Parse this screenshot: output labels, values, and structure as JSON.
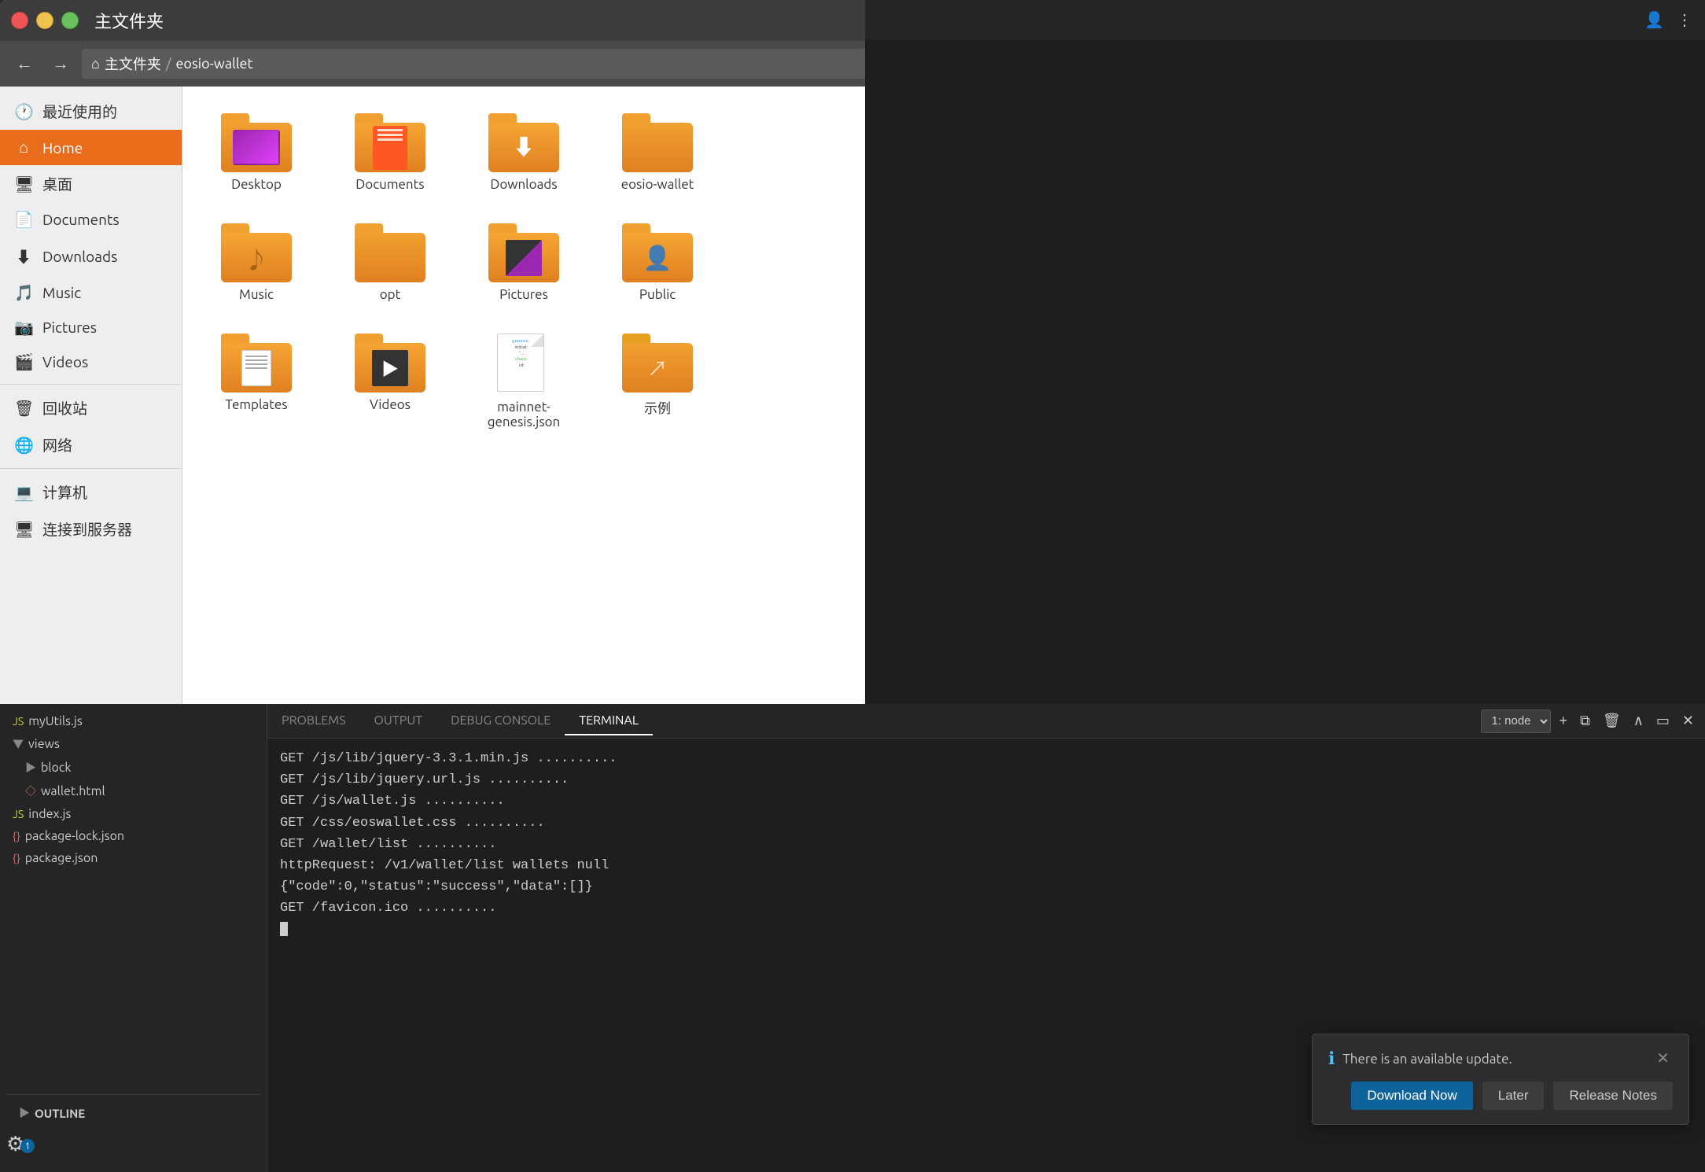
{
  "window": {
    "title": "主文件夹",
    "breadcrumb_home": "⌂主文件夹",
    "breadcrumb_sep": "/",
    "breadcrumb_sub": "eosio-wallet"
  },
  "sidebar": {
    "items": [
      {
        "id": "recent",
        "label": "最近使用的",
        "icon": "🕐"
      },
      {
        "id": "home",
        "label": "Home",
        "icon": "🏠",
        "active": true
      },
      {
        "id": "desktop",
        "label": "桌面",
        "icon": "🖥"
      },
      {
        "id": "documents",
        "label": "Documents",
        "icon": "📄"
      },
      {
        "id": "downloads",
        "label": "Downloads",
        "icon": "⬇"
      },
      {
        "id": "music",
        "label": "Music",
        "icon": "🎵"
      },
      {
        "id": "pictures",
        "label": "Pictures",
        "icon": "📷"
      },
      {
        "id": "videos",
        "label": "Videos",
        "icon": "🎬"
      },
      {
        "id": "trash",
        "label": "回收站",
        "icon": "🗑"
      },
      {
        "id": "network",
        "label": "网络",
        "icon": "🌐"
      },
      {
        "id": "computer",
        "label": "计算机",
        "icon": "💻"
      },
      {
        "id": "server",
        "label": "连接到服务器",
        "icon": "🖧"
      }
    ]
  },
  "files": [
    {
      "id": "desktop",
      "name": "Desktop",
      "type": "folder-desktop"
    },
    {
      "id": "documents",
      "name": "Documents",
      "type": "folder-documents"
    },
    {
      "id": "downloads",
      "name": "Downloads",
      "type": "folder-downloads"
    },
    {
      "id": "eosio-wallet",
      "name": "eosio-wallet",
      "type": "folder-plain"
    },
    {
      "id": "music",
      "name": "Music",
      "type": "folder-music"
    },
    {
      "id": "opt",
      "name": "opt",
      "type": "folder-plain"
    },
    {
      "id": "pictures",
      "name": "Pictures",
      "type": "folder-pictures"
    },
    {
      "id": "public",
      "name": "Public",
      "type": "folder-public"
    },
    {
      "id": "templates",
      "name": "Templates",
      "type": "folder-templates"
    },
    {
      "id": "videos",
      "name": "Videos",
      "type": "folder-videos"
    },
    {
      "id": "json",
      "name": "mainnet-genesis.\njson",
      "type": "file-json"
    },
    {
      "id": "example",
      "name": "示例",
      "type": "folder-share"
    }
  ],
  "terminal": {
    "tabs": [
      {
        "label": "PROBLEMS",
        "active": false
      },
      {
        "label": "OUTPUT",
        "active": false
      },
      {
        "label": "DEBUG CONSOLE",
        "active": false
      },
      {
        "label": "TERMINAL",
        "active": true
      }
    ],
    "selector": "1: node",
    "lines": [
      "GET /js/lib/jquery-3.3.1.min.js ..........",
      "GET /js/lib/jquery.url.js ..........",
      "GET /js/wallet.js ..........",
      "GET /css/eoswallet.css ..........",
      "GET /wallet/list ..........",
      "httpRequest: /v1/wallet/list wallets null",
      "{\"code\":0,\"status\":\"success\",\"data\":[]}",
      "GET /favicon.ico .........."
    ]
  },
  "explorer": {
    "items": [
      {
        "label": "myUtils.js",
        "type": "js",
        "indent": 0
      },
      {
        "label": "views",
        "type": "folder",
        "indent": 0,
        "expanded": true
      },
      {
        "label": "block",
        "type": "folder",
        "indent": 1,
        "expanded": false
      },
      {
        "label": "wallet.html",
        "type": "html",
        "indent": 1
      },
      {
        "label": "index.js",
        "type": "js",
        "indent": 0
      },
      {
        "label": "package-lock.json",
        "type": "json",
        "indent": 0
      },
      {
        "label": "package.json",
        "type": "json",
        "indent": 0
      }
    ],
    "outline": "OUTLINE"
  },
  "notification": {
    "icon": "ℹ",
    "message": "There is an available update.",
    "btn_download": "Download Now",
    "btn_later": "Later",
    "btn_release": "Release Notes"
  },
  "gear": {
    "badge": "1"
  }
}
